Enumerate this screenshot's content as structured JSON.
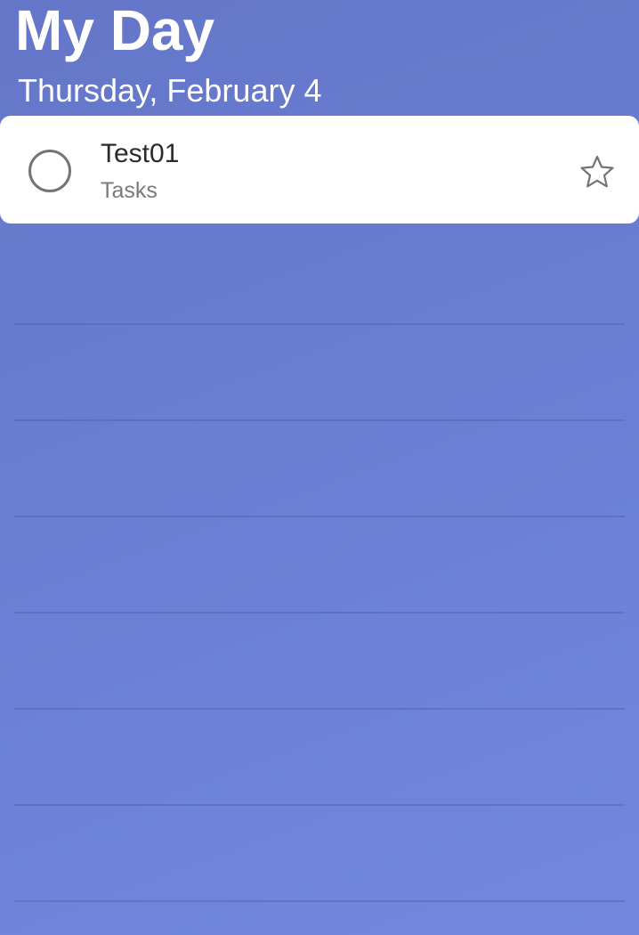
{
  "header": {
    "title": "My Day",
    "date": "Thursday, February 4"
  },
  "tasks": [
    {
      "title": "Test01",
      "list": "Tasks",
      "completed": false,
      "important": false,
      "checkbox_icon": "circle-icon",
      "star_icon": "star-outline-icon"
    }
  ],
  "colors": {
    "background_start": "#6576c8",
    "background_end": "#7388dd",
    "card": "#ffffff",
    "title_text": "#ffffff",
    "task_text": "#2b2b2b",
    "secondary_text": "#7a7a7a",
    "icon": "#747474"
  }
}
